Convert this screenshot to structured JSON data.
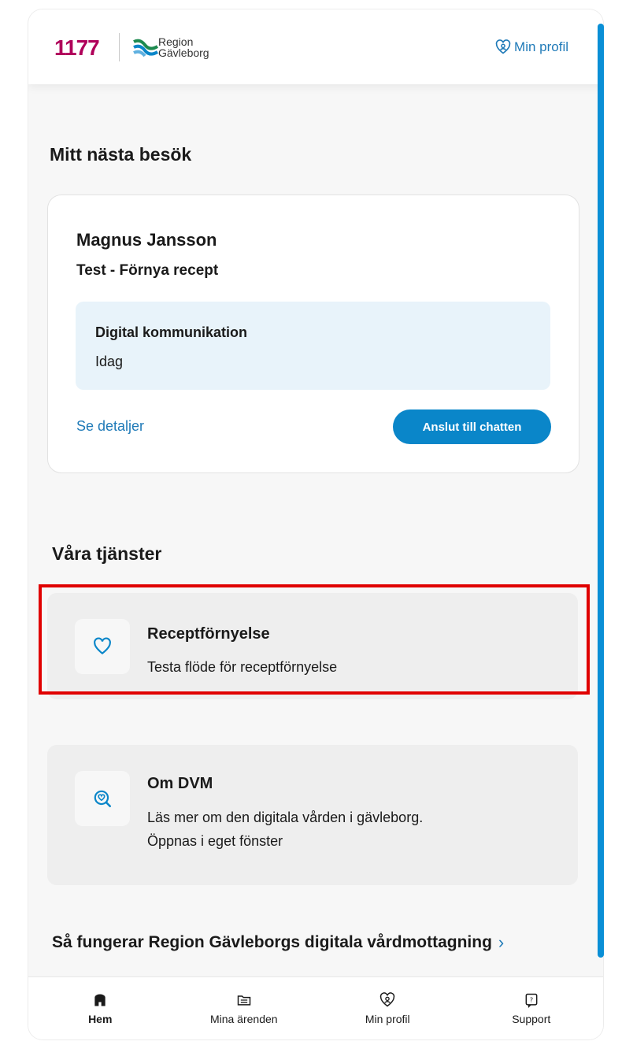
{
  "header": {
    "logo_number": "1177",
    "region_line1": "Region",
    "region_line2": "Gävleborg",
    "profile_link": "Min profil"
  },
  "next_visit": {
    "section_title": "Mitt nästa besök",
    "name": "Magnus Jansson",
    "subject": "Test - Förnya recept",
    "type": "Digital kommunikation",
    "when": "Idag",
    "details_link": "Se detaljer",
    "chat_button": "Anslut till chatten"
  },
  "services": {
    "section_title": "Våra tjänster",
    "items": [
      {
        "title": "Receptförnyelse",
        "description": "Testa flöde för receptförnyelse",
        "icon": "heart-icon"
      },
      {
        "title": "Om DVM",
        "description_line1": "Läs mer om den digitala vården i gävleborg.",
        "description_line2": "Öppnas i eget fönster",
        "icon": "search-heart-icon"
      }
    ]
  },
  "footer_link": "Så fungerar Region Gävleborgs digitala vårdmottagning",
  "bottom_nav": [
    {
      "label": "Hem",
      "icon": "home-icon",
      "active": true
    },
    {
      "label": "Mina ärenden",
      "icon": "folder-icon",
      "active": false
    },
    {
      "label": "Min profil",
      "icon": "profile-icon",
      "active": false
    },
    {
      "label": "Support",
      "icon": "help-icon",
      "active": false
    }
  ],
  "colors": {
    "accent": "#0a86c9",
    "link": "#1f7ab8",
    "brand_1177": "#b0005a",
    "highlight": "#e00000"
  }
}
